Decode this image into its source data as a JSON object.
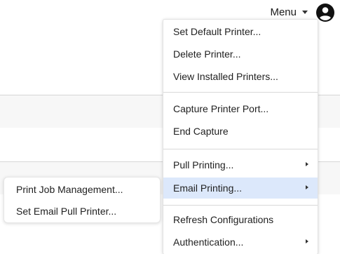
{
  "header": {
    "menu_label": "Menu",
    "caret_icon": "caret-down-icon",
    "account_icon": "account-circle-icon"
  },
  "menu": {
    "set_default_printer": "Set Default Printer...",
    "delete_printer": "Delete Printer...",
    "view_installed_printers": "View Installed Printers...",
    "capture_printer_port": "Capture Printer Port...",
    "end_capture": "End Capture",
    "pull_printing": "Pull Printing...",
    "email_printing": "Email Printing...",
    "refresh_configurations": "Refresh Configurations",
    "authentication": "Authentication..."
  },
  "submenu": {
    "print_job_management": "Print Job Management...",
    "set_email_pull_printer": "Set Email Pull Printer..."
  },
  "colors": {
    "highlight": "#dce8fb",
    "text": "#1f1f1f",
    "band": "#f7f7f7"
  }
}
